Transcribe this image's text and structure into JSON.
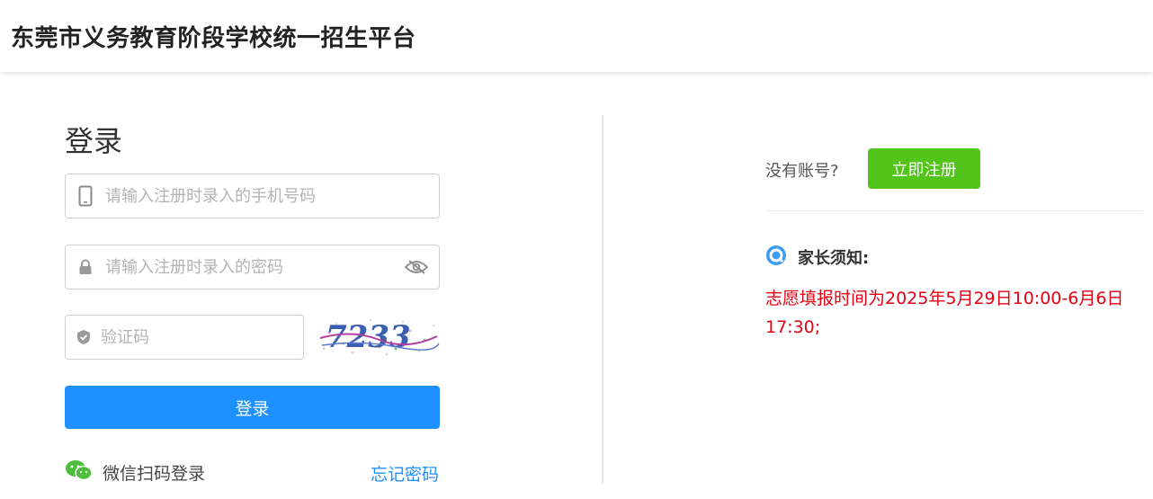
{
  "header": {
    "title": "东莞市义务教育阶段学校统一招生平台"
  },
  "login": {
    "title": "登录",
    "phone_placeholder": "请输入注册时录入的手机号码",
    "password_placeholder": "请输入注册时录入的密码",
    "captcha_placeholder": "验证码",
    "captcha_text": "7233",
    "submit_label": "登录",
    "wechat_label": "微信扫码登录",
    "forgot_label": "忘记密码"
  },
  "register": {
    "prompt": "没有账号?",
    "button_label": "立即注册"
  },
  "notice": {
    "title": "家长须知:",
    "text": "志愿填报时间为2025年5月29日10:00-6月6日17:30;"
  },
  "colors": {
    "primary": "#1e90ff",
    "register": "#52c41a",
    "notice_text": "#e60012",
    "notice_icon": "#3d9cf0",
    "wechat": "#4cbf3a"
  },
  "icons": {
    "phone": "phone-icon",
    "lock": "lock-icon",
    "eye_off": "eye-off-icon",
    "shield": "shield-icon",
    "wechat": "wechat-icon",
    "notice": "notice-icon"
  }
}
